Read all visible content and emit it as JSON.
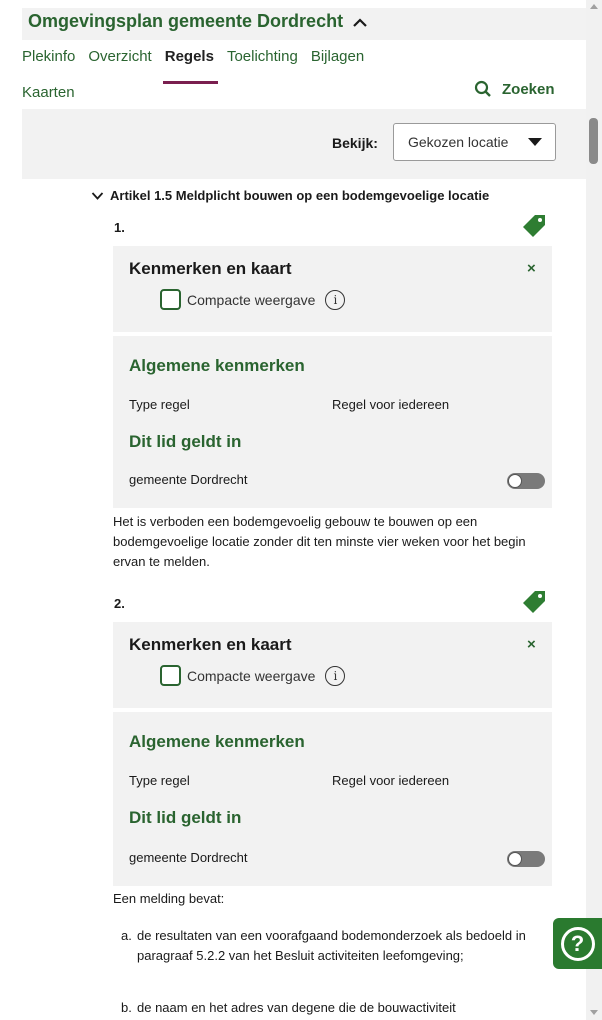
{
  "header": {
    "title": "Omgevingsplan gemeente Dordrecht"
  },
  "tabs": [
    {
      "label": "Plekinfo"
    },
    {
      "label": "Overzicht"
    },
    {
      "label": "Regels"
    },
    {
      "label": "Toelichting"
    },
    {
      "label": "Bijlagen"
    },
    {
      "label": "Kaarten"
    }
  ],
  "search": {
    "label": "Zoeken"
  },
  "view": {
    "label": "Bekijk:",
    "selected": "Gekozen locatie"
  },
  "article": {
    "title": "Artikel 1.5 Meldplicht bouwen op een bodemgevoelige locatie"
  },
  "members": [
    {
      "number": "1.",
      "panel_title": "Kenmerken en kaart",
      "close": "×",
      "compact_label": "Compacte weergave",
      "general_title": "Algemene kenmerken",
      "type_label": "Type regel",
      "type_value": "Regel voor iedereen",
      "applies_title": "Dit lid geldt in",
      "location": "gemeente Dordrecht",
      "text": "Het is verboden een bodemgevoelig gebouw te bouwen op een bodemgevoelige locatie zonder dit ten minste vier weken voor het begin ervan te melden."
    },
    {
      "number": "2.",
      "panel_title": "Kenmerken en kaart",
      "close": "×",
      "compact_label": "Compacte weergave",
      "general_title": "Algemene kenmerken",
      "type_label": "Type regel",
      "type_value": "Regel voor iedereen",
      "applies_title": "Dit lid geldt in",
      "location": "gemeente Dordrecht",
      "text": "Een melding bevat:"
    }
  ],
  "list": [
    {
      "marker": "a.",
      "text": "de resultaten van een voorafgaand bodemonderzoek als bedoeld in paragraaf 5.2.2 van het Besluit activiteiten leefomgeving;"
    },
    {
      "marker": "b.",
      "text": "de naam en het adres van degene die de bouwactiviteit"
    }
  ],
  "help": {
    "symbol": "?"
  },
  "colors": {
    "brand_green": "#2a6430",
    "active_tab_underline": "#7a1f4f",
    "panel_bg": "#f2f2f2",
    "help_green": "#2a7a2f"
  },
  "icons": [
    "chevron-up-icon",
    "search-icon",
    "dropdown-arrow-icon",
    "chevron-down-icon",
    "tag-icon",
    "close-icon",
    "info-icon",
    "help-icon"
  ]
}
